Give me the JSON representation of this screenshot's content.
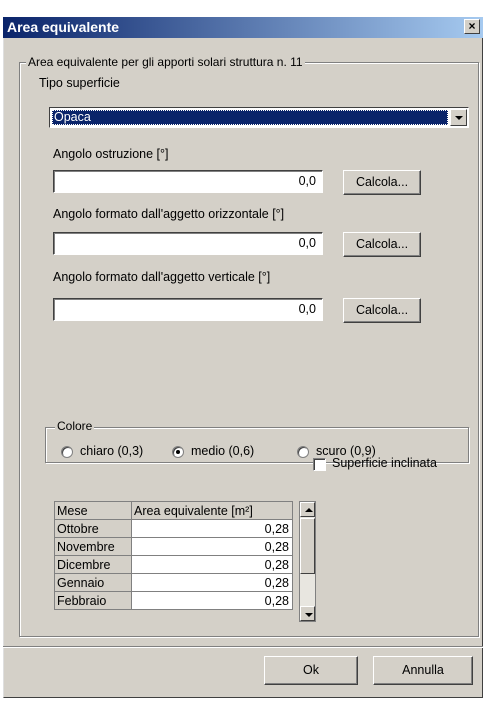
{
  "window": {
    "title": "Area equivalente",
    "close_label": "×"
  },
  "group_main": {
    "label": "Area equivalente per gli apporti solari struttura n. 11"
  },
  "tipo_superficie": {
    "label": "Tipo superficie",
    "selected": "Opaca"
  },
  "angolo_ostruzione": {
    "label": "Angolo ostruzione [°]",
    "value": "0,0",
    "button": "Calcola..."
  },
  "aggetto_orizzontale": {
    "label": "Angolo formato dall'aggetto orizzontale [°]",
    "value": "0,0",
    "button": "Calcola..."
  },
  "aggetto_verticale": {
    "label": "Angolo formato dall'aggetto verticale [°]",
    "value": "0,0",
    "button": "Calcola..."
  },
  "colore": {
    "label": "Colore",
    "options": [
      {
        "label": "chiaro (0,3)",
        "selected": false
      },
      {
        "label": "medio (0,6)",
        "selected": true
      },
      {
        "label": "scuro (0,9)",
        "selected": false
      }
    ]
  },
  "superficie_inclinata": {
    "label": "Superficie inclinata",
    "checked": false
  },
  "table": {
    "headers": [
      "Mese",
      "Area equivalente [m²]"
    ],
    "rows": [
      [
        "Ottobre",
        "0,28"
      ],
      [
        "Novembre",
        "0,28"
      ],
      [
        "Dicembre",
        "0,28"
      ],
      [
        "Gennaio",
        "0,28"
      ],
      [
        "Febbraio",
        "0,28"
      ]
    ]
  },
  "buttons": {
    "ok": "Ok",
    "annulla": "Annulla"
  },
  "colors": {
    "title_start": "#0a246a",
    "title_end": "#a6caf0",
    "face": "#d4d0c8",
    "selection": "#0a246a"
  }
}
